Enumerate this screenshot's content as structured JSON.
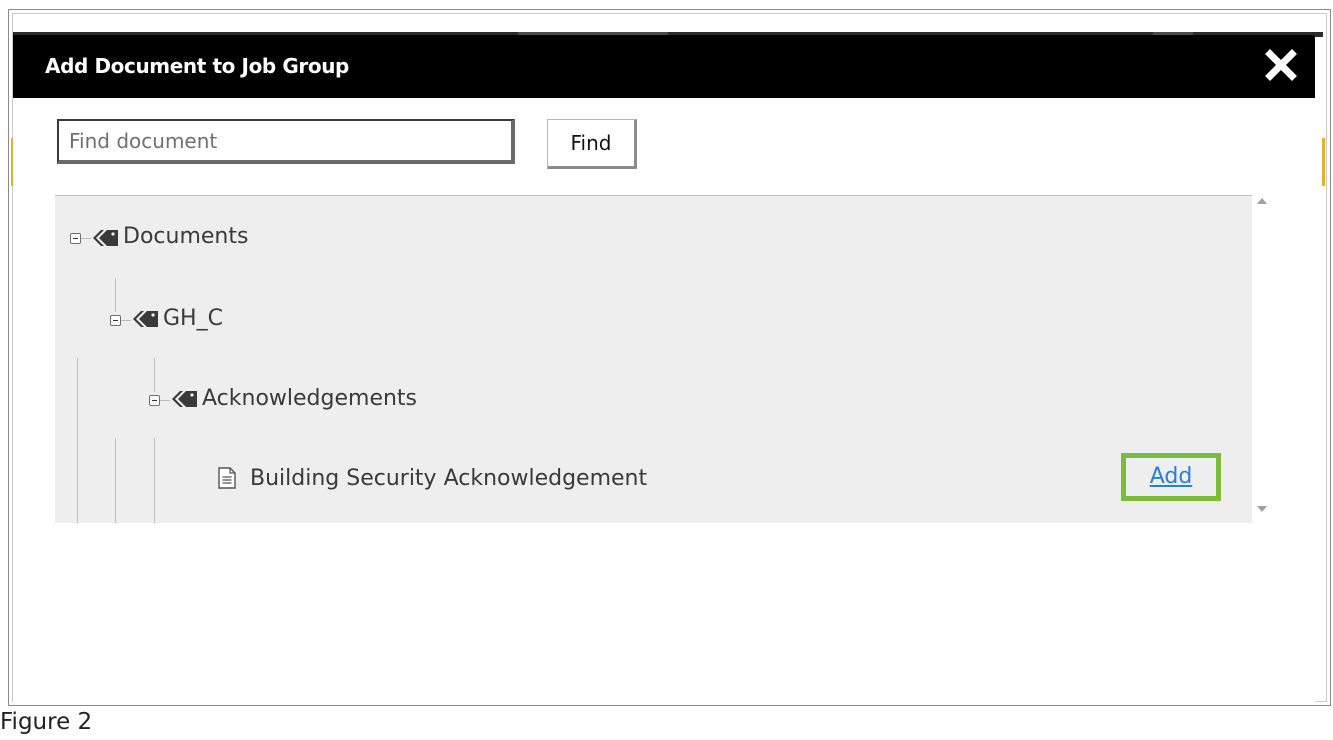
{
  "dialog": {
    "title": "Add Document to Job Group",
    "close_icon": "close-x-icon"
  },
  "search": {
    "placeholder": "Find document",
    "value": "",
    "button_label": "Find"
  },
  "tree": {
    "root": {
      "label": "Documents",
      "icon": "tag-icon",
      "expanded": true
    },
    "folder": {
      "label": "GH_C",
      "icon": "tag-icon",
      "expanded": true
    },
    "subfolder": {
      "label": "Acknowledgements",
      "icon": "tag-icon",
      "expanded": true
    },
    "document": {
      "label": "Building Security Acknowledgement",
      "icon": "document-icon",
      "action_label": "Add"
    }
  },
  "colors": {
    "titlebar": "#000000",
    "tree_background": "#eeeeef",
    "add_highlight": "#7dbb3a",
    "link": "#2a7fd4"
  },
  "caption": "Figure 2"
}
